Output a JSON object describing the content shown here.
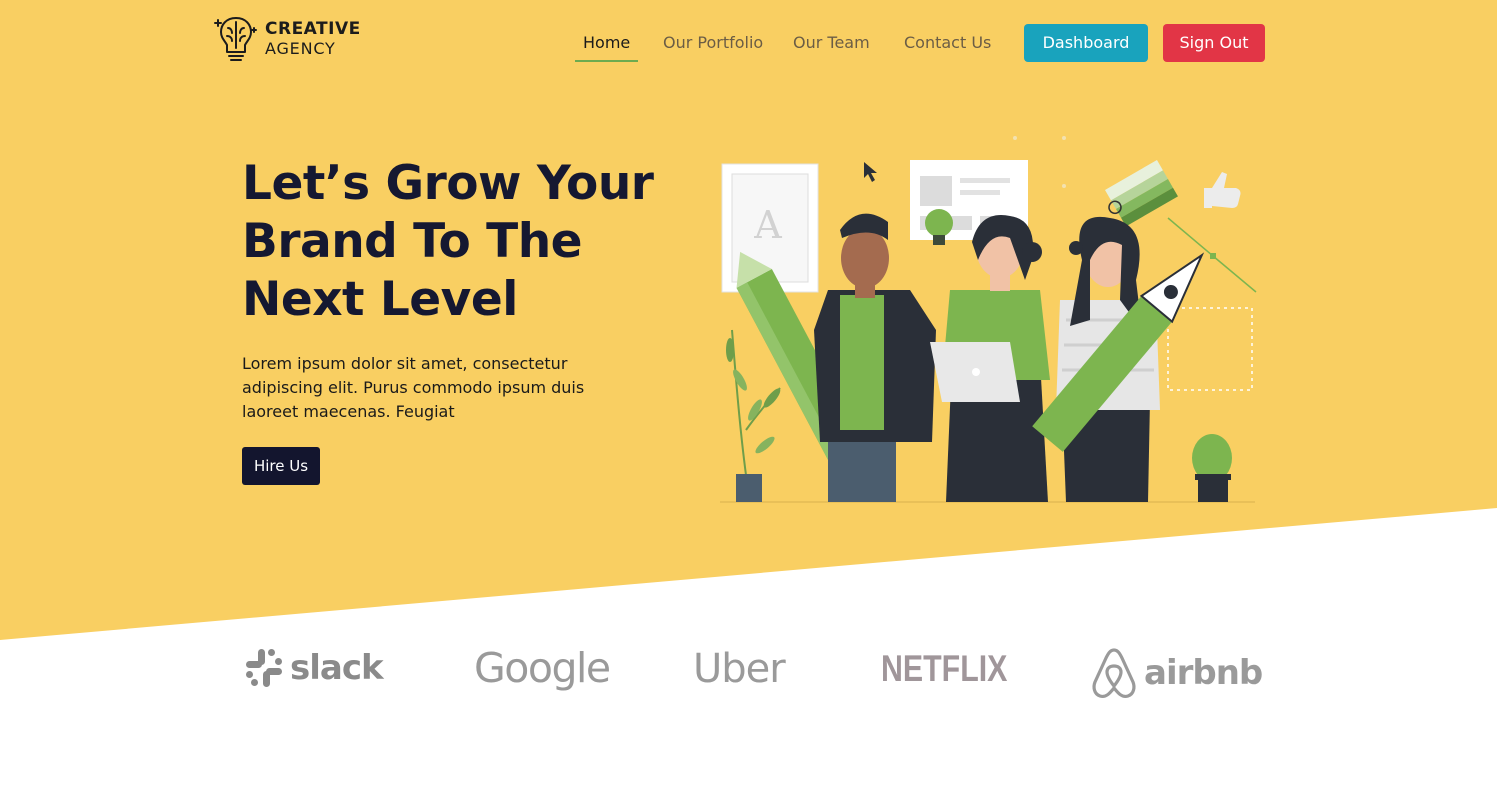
{
  "colors": {
    "hero_background": "#F9CF62",
    "accent_green": "#6DAB4F",
    "dashboard_button": "#19A3BD",
    "sign_out_button": "#E23546",
    "dark_navy": "#13152E"
  },
  "logo": {
    "icon": "brain-bulb-icon",
    "line1": "CREATIVE",
    "line2": "AGENCY"
  },
  "nav": {
    "items": [
      {
        "label": "Home",
        "active": true
      },
      {
        "label": "Our Portfolio",
        "active": false
      },
      {
        "label": "Our Team",
        "active": false
      },
      {
        "label": "Contact Us",
        "active": false
      }
    ],
    "dashboard_label": "Dashboard",
    "sign_out_label": "Sign Out"
  },
  "hero": {
    "title_line1": "Let’s Grow Your",
    "title_line2": "Brand To The",
    "title_line3": "Next Level",
    "description": "Lorem ipsum dolor sit amet, consectetur adipiscing elit. Purus commodo ipsum duis laoreet maecenas. Feugiat",
    "cta_label": "Hire Us",
    "illustration": "creative-team-illustration"
  },
  "brands": [
    {
      "name": "slack",
      "icon": "slack-icon"
    },
    {
      "name": "Google",
      "icon": "google-logo"
    },
    {
      "name": "Uber",
      "icon": "uber-logo"
    },
    {
      "name": "NETFLIX",
      "icon": "netflix-logo"
    },
    {
      "name": "airbnb",
      "icon": "airbnb-icon"
    }
  ]
}
